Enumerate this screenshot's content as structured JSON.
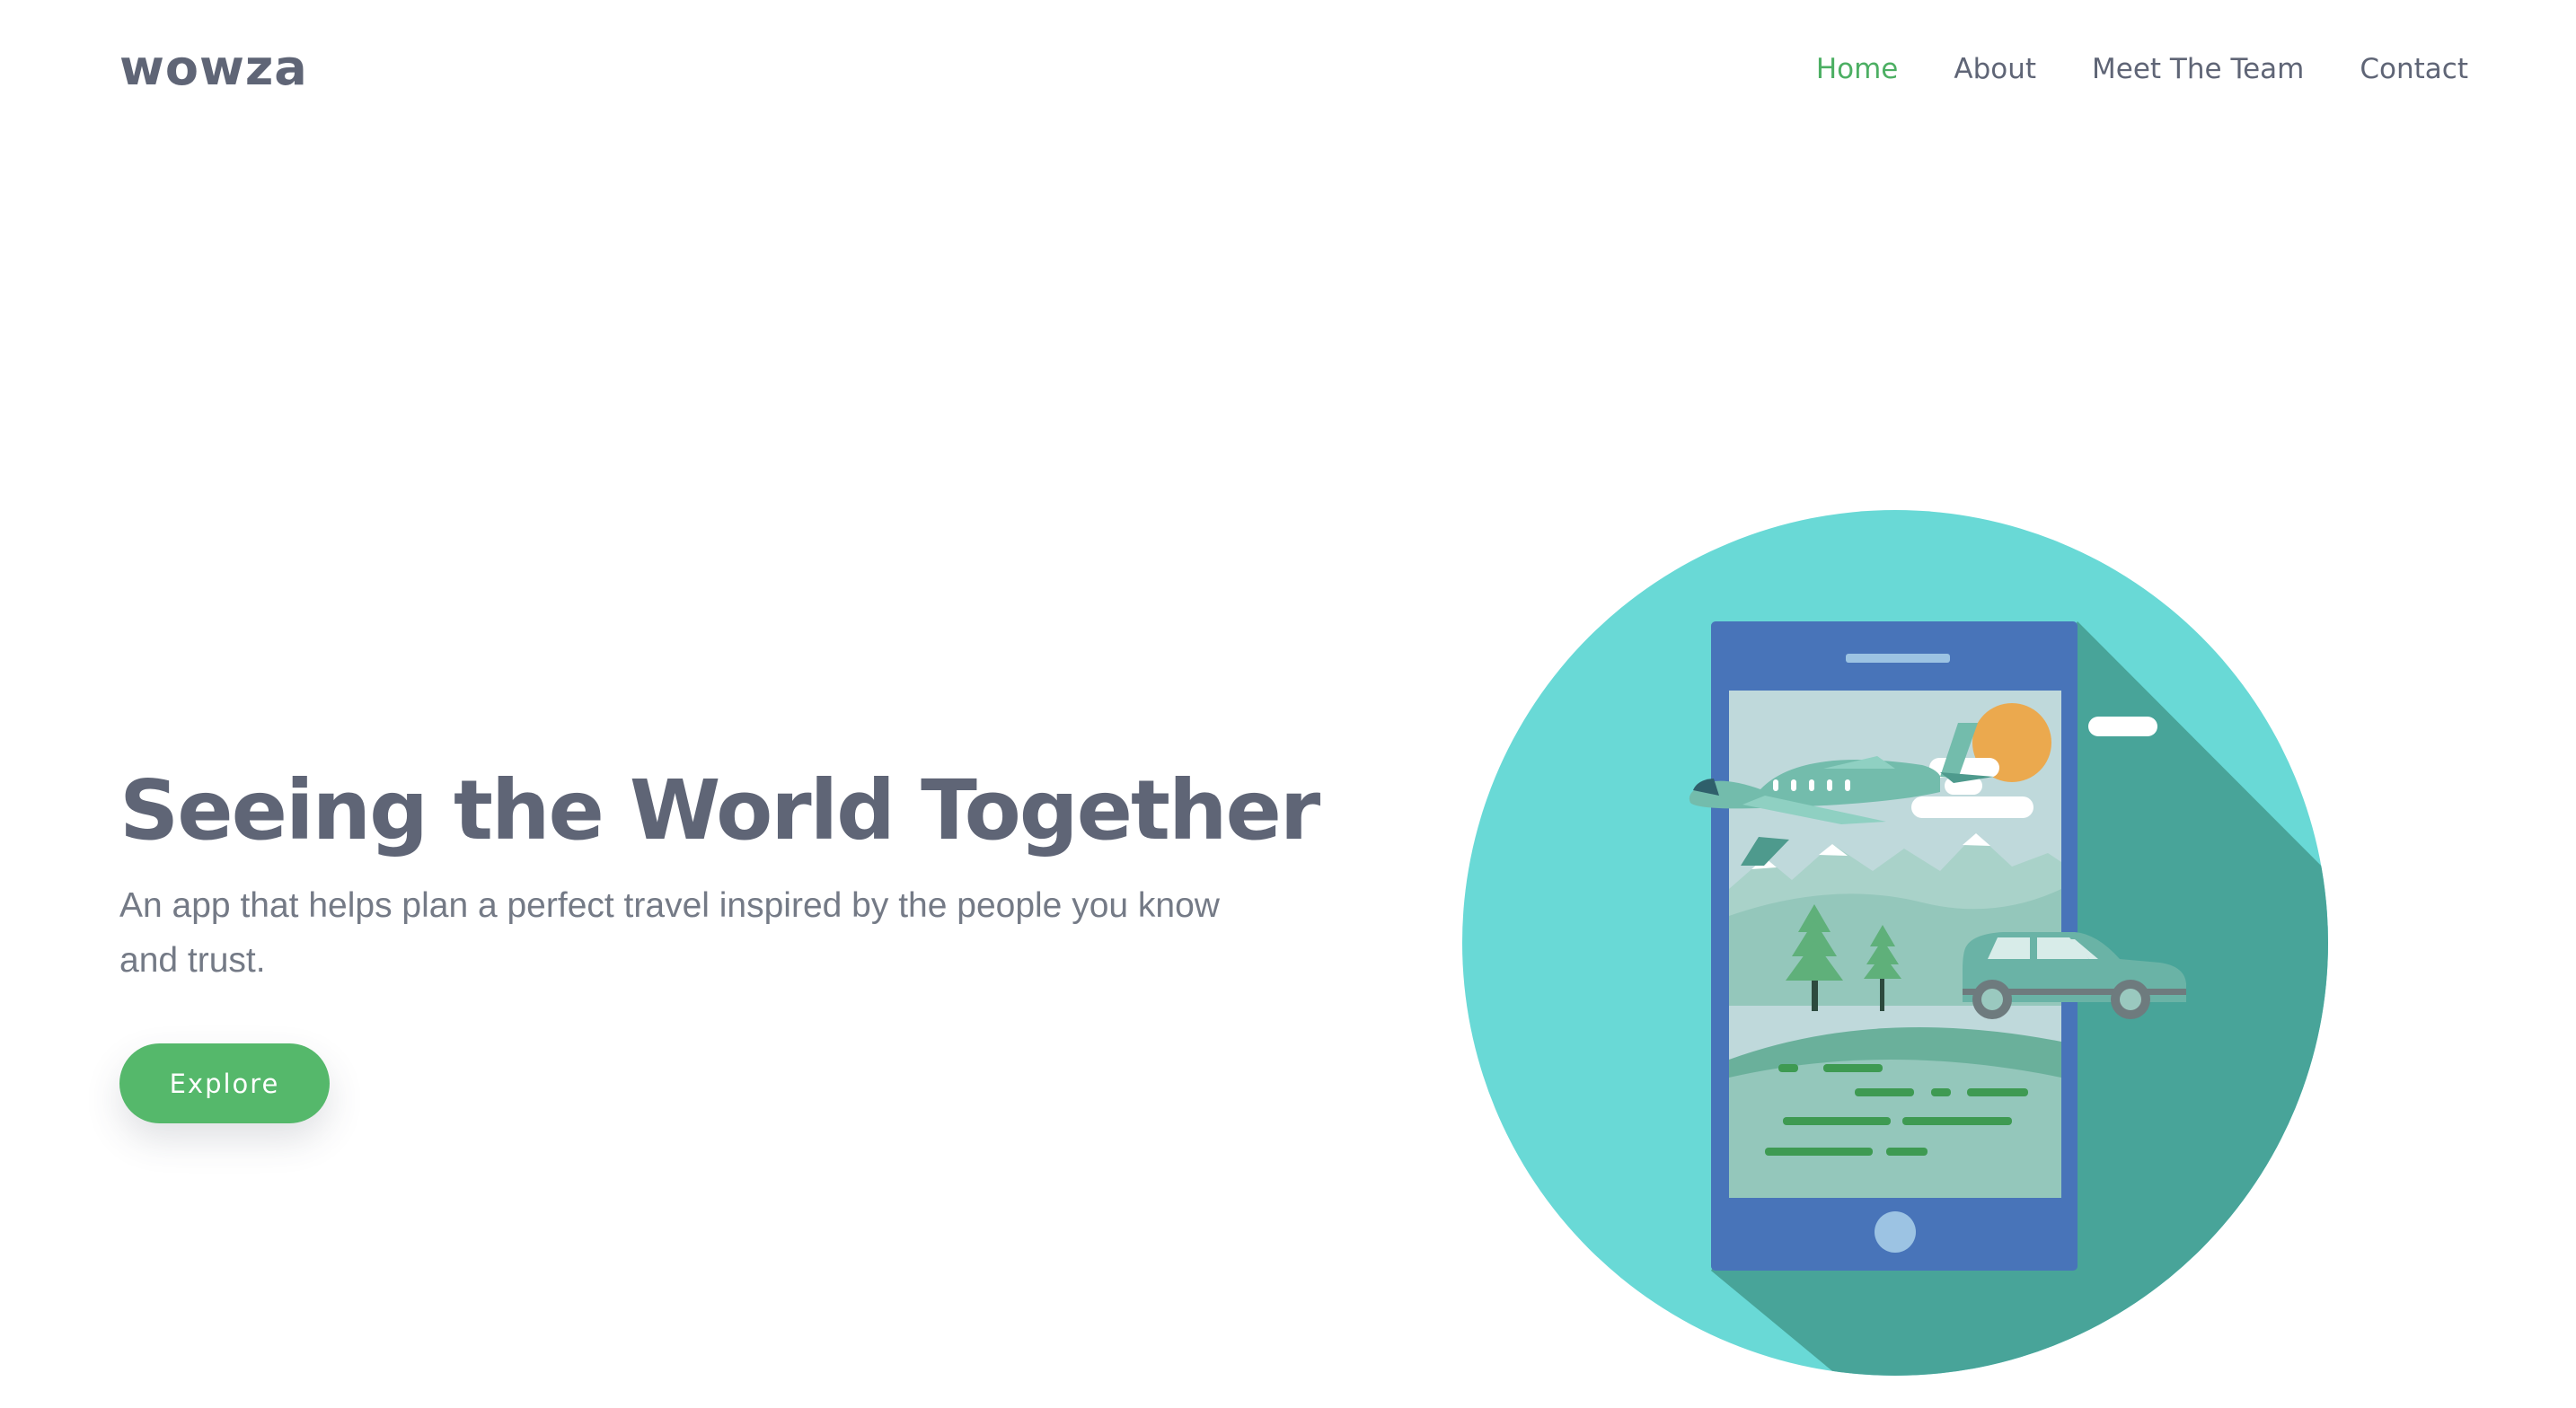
{
  "header": {
    "logo": "wowza",
    "nav": {
      "home": "Home",
      "about": "About",
      "team": "Meet The Team",
      "contact": "Contact"
    }
  },
  "hero": {
    "title": "Seeing the World Together",
    "subtitle": "An app that helps plan a perfect travel inspired by the people you know and trust.",
    "button": "Explore"
  },
  "illustration": {
    "icon": "travel-phone-illustration",
    "colors": {
      "circle": "#69d9d6",
      "shadow": "#48a499",
      "phone": "#4874b9",
      "screen_sky": "#bfd9db",
      "sun": "#eba94e",
      "grass": "#94c7bb",
      "tree": "#5fb07a",
      "car": "#6ab3a6",
      "plane": "#73bcac"
    }
  },
  "theme": {
    "accent": "#55b86b",
    "text": "#5f6576"
  }
}
